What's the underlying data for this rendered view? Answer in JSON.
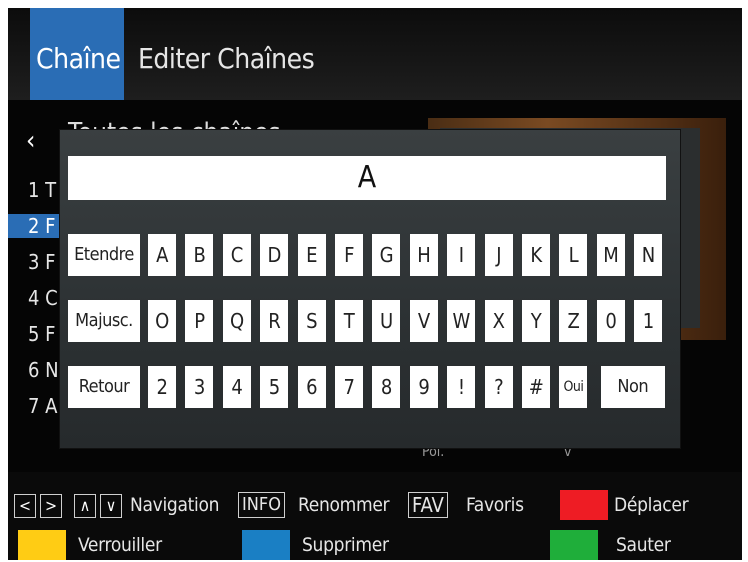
{
  "header": {
    "tabs": [
      {
        "label": "Chaîne",
        "active": true
      },
      {
        "label": "Editer Chaînes",
        "active": false
      }
    ]
  },
  "background_list": {
    "title": "Toutes les chaînes",
    "rows": [
      "1 T",
      "2 F",
      "3 F",
      "4 C",
      "5 F",
      "6 N",
      "7 A"
    ],
    "selected_index": 1,
    "bottom_texts": [
      "Pol.",
      "v"
    ]
  },
  "keyboard": {
    "input_value": "A",
    "rows": [
      [
        "Etendre",
        "A",
        "B",
        "C",
        "D",
        "E",
        "F",
        "G",
        "H",
        "I",
        "J",
        "K",
        "L",
        "M",
        "N"
      ],
      [
        "Majusc.",
        "O",
        "P",
        "Q",
        "R",
        "S",
        "T",
        "U",
        "V",
        "W",
        "X",
        "Y",
        "Z",
        "0",
        "1"
      ],
      [
        "Retour",
        "2",
        "3",
        "4",
        "5",
        "6",
        "7",
        "8",
        "9",
        "!",
        "?",
        "#",
        "Oui",
        "Non"
      ]
    ]
  },
  "legend": {
    "nav_arrows": [
      "<",
      ">",
      "∧",
      "∨"
    ],
    "navigation_label": "Navigation",
    "info_tag": "INFO",
    "rename_label": "Renommer",
    "fav_tag": "FAV",
    "favorites_label": "Favoris",
    "move_label": "Déplacer",
    "lock_label": "Verrouiller",
    "delete_label": "Supprimer",
    "skip_label": "Sauter"
  },
  "colors": {
    "accent": "#2a6db5",
    "red": "#ee1c24",
    "yellow": "#ffcc14",
    "blue": "#1a7fc4",
    "green": "#1fae3a"
  }
}
